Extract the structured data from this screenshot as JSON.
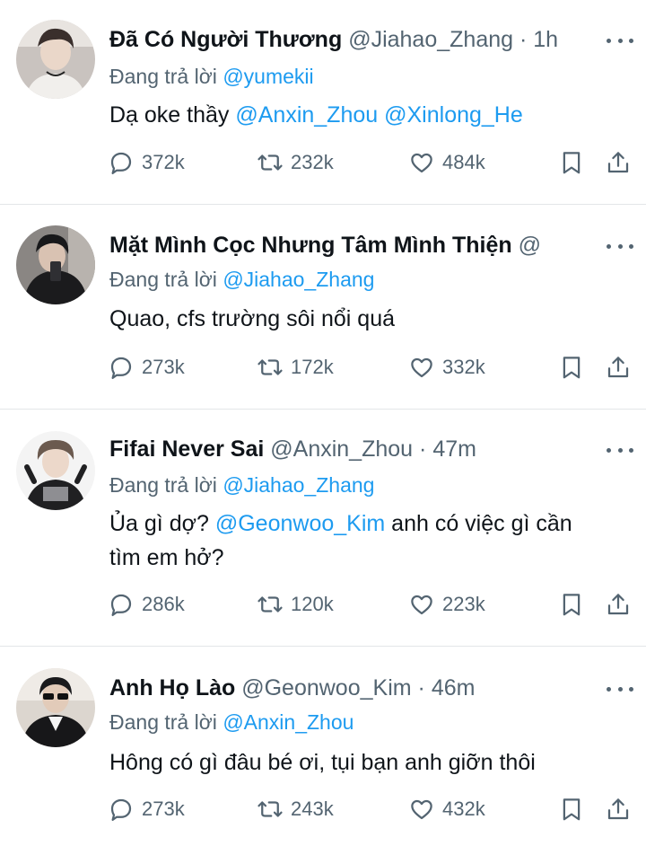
{
  "tweets": [
    {
      "name": "Đã Có Người Thương",
      "handle": "@Jiahao_Zhang",
      "dot": "·",
      "time": "1h",
      "reply_prefix": "Đang trả lời",
      "reply_to": "@yumekii",
      "text_parts": [
        "Dạ oke thầy ",
        "@Anxin_Zhou",
        " ",
        "@Xinlong_He"
      ],
      "replies": "372k",
      "retweets": "232k",
      "likes": "484k"
    },
    {
      "name": "Mặt Mình Cọc Nhưng Tâm Mình Thiện",
      "handle": "@",
      "dot": "",
      "time": "",
      "reply_prefix": "Đang trả lời",
      "reply_to": "@Jiahao_Zhang",
      "text_parts": [
        "Quao, cfs trường sôi nổi quá"
      ],
      "replies": "273k",
      "retweets": "172k",
      "likes": "332k"
    },
    {
      "name": "Fifai Never Sai",
      "handle": "@Anxin_Zhou",
      "dot": "·",
      "time": "47m",
      "reply_prefix": "Đang trả lời",
      "reply_to": "@Jiahao_Zhang",
      "text_parts": [
        "Ủa gì dợ? ",
        "@Geonwoo_Kim",
        " anh có việc gì cần tìm em hở?"
      ],
      "replies": "286k",
      "retweets": "120k",
      "likes": "223k"
    },
    {
      "name": "Anh Họ Lào",
      "handle": "@Geonwoo_Kim",
      "dot": "·",
      "time": "46m",
      "reply_prefix": "Đang trả lời",
      "reply_to": "@Anxin_Zhou",
      "text_parts": [
        "Hông có gì đâu bé ơi, tụi bạn anh giỡn thôi"
      ],
      "replies": "273k",
      "retweets": "243k",
      "likes": "432k"
    }
  ],
  "icons": {
    "reply": "speech-bubble-icon",
    "retweet": "retweet-arrows-icon",
    "like": "heart-icon",
    "bookmark": "bookmark-icon",
    "share": "share-upload-icon",
    "more": "more-dots-icon"
  },
  "colors": {
    "link": "#1d9bf0",
    "secondary_text": "#536471",
    "primary_text": "#0f1419",
    "divider": "#e3e6e8"
  }
}
